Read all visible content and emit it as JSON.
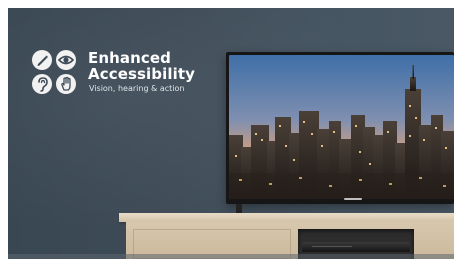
{
  "promo": {
    "title_line1": "Enhanced",
    "title_line2": "Accessibility",
    "subtitle": "Vision, hearing & action",
    "icons": [
      "pen-icon",
      "eye-icon",
      "ear-icon",
      "hand-icon"
    ]
  },
  "colors": {
    "wall": "#3f4c58",
    "text": "#ffffff",
    "icon_bg": "#f2f2f2",
    "cabinet": "#d7c7ad",
    "tv_frame": "#161616"
  }
}
